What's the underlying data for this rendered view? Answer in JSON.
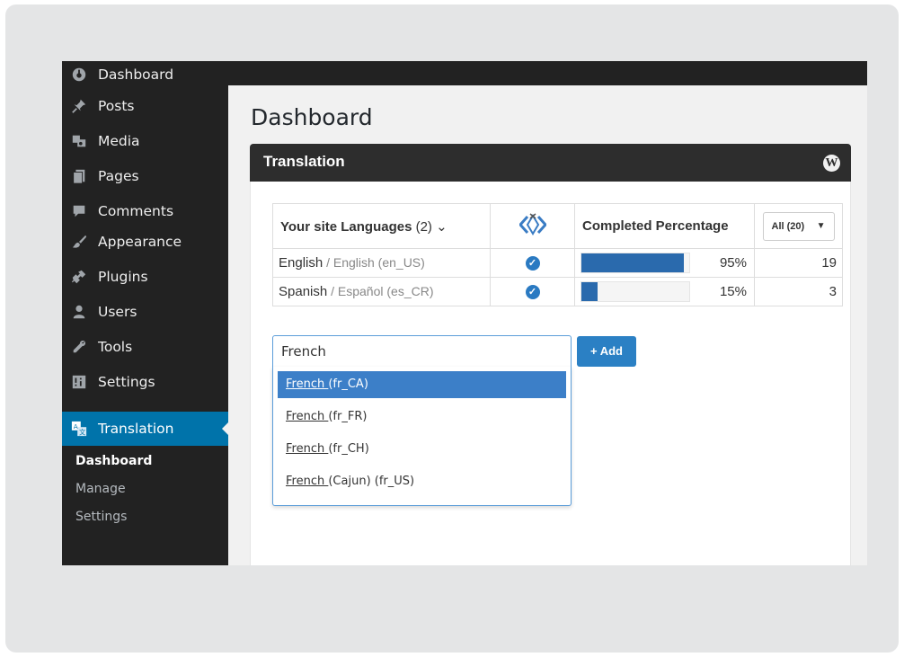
{
  "sidebar": {
    "items": [
      {
        "label": "Dashboard",
        "icon": "dashboard-icon"
      },
      {
        "label": "Posts",
        "icon": "pushpin-icon"
      },
      {
        "label": "Media",
        "icon": "media-icon"
      },
      {
        "label": "Pages",
        "icon": "pages-icon"
      },
      {
        "label": "Comments",
        "icon": "comment-icon"
      },
      {
        "label": "Appearance",
        "icon": "paintbrush-icon"
      },
      {
        "label": "Plugins",
        "icon": "plugin-icon"
      },
      {
        "label": "Users",
        "icon": "user-icon"
      },
      {
        "label": "Tools",
        "icon": "wrench-icon"
      },
      {
        "label": "Settings",
        "icon": "settings-icon"
      },
      {
        "label": "Translation",
        "icon": "translate-icon"
      }
    ],
    "submenu": [
      "Dashboard",
      "Manage",
      "Settings"
    ]
  },
  "page": {
    "title": "Dashboard"
  },
  "panel": {
    "title": "Translation",
    "logo": "W"
  },
  "table": {
    "header_languages": "Your site Languages",
    "header_count": "(2) ⌄",
    "header_icon": "language-swap-icon",
    "header_percentage": "Completed Percentage",
    "filter_value": "All (20)",
    "rows": [
      {
        "name": "English",
        "native": " / English (en_US)",
        "progress": 0.95,
        "percent": "95%",
        "count": "19"
      },
      {
        "name": "Spanish",
        "native": " / Español (es_CR)",
        "progress": 0.15,
        "percent": "15%",
        "count": "3"
      }
    ]
  },
  "add_language": {
    "input_value": "French",
    "button_label": "+ Add",
    "options": [
      {
        "name": "French ",
        "code": "(fr_CA)"
      },
      {
        "name": "French ",
        "code": "(fr_FR)"
      },
      {
        "name": "French ",
        "code": "(fr_CH)"
      },
      {
        "name": "French ",
        "code": "(Cajun) (fr_US)"
      }
    ]
  },
  "colors": {
    "accent": "#0073aa",
    "bar": "#2a6aad",
    "dropdown_highlight": "#3c7fc8"
  }
}
